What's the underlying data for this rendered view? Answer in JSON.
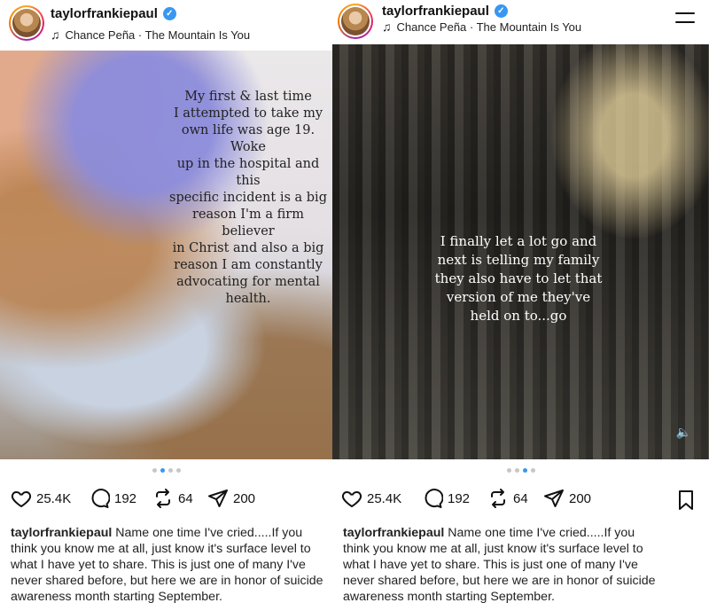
{
  "left_post": {
    "username": "taylorfrankiepaul",
    "music": "Chance Peña · The Mountain Is You",
    "overlay_lines": [
      "My first & last time",
      "I attempted to take my",
      "own life was age 19. Woke",
      "up in the hospital and this",
      "specific incident is a big",
      "reason I'm a firm believer",
      "in Christ and also a big",
      "reason I am constantly",
      "advocating for mental",
      "health."
    ],
    "carousel_dots": 4,
    "active_dot": 2,
    "likes": "25.4K",
    "comments": "192",
    "reposts": "64",
    "shares": "200",
    "caption_username": "taylorfrankiepaul",
    "caption_lines": [
      "Name one time I've cried.....If you",
      "think you know me at all, just know it's surface level to",
      "what I have yet to share. This is just one of many I've",
      "never shared before, but here we are in honor of suicide",
      "awareness month starting September."
    ]
  },
  "right_post": {
    "username": "taylorfrankiepaul",
    "music": "Chance Peña · The Mountain Is You",
    "overlay_lines": [
      "I finally let a lot go and",
      "next is telling my family",
      "they also have to let that",
      "version of me they've",
      "held on to...go"
    ],
    "carousel_dots": 4,
    "active_dot": 3,
    "likes": "25.4K",
    "comments": "192",
    "reposts": "64",
    "shares": "200",
    "caption_username": "taylorfrankiepaul",
    "caption_lines": [
      "Name one time I've cried.....If you",
      "think you know me at all, just know it's surface level to",
      "what I have yet to share. This is just one of many I've",
      "never shared before, but here we are in honor of suicide",
      "awareness month starting September."
    ]
  },
  "icons": {
    "verified": "verified-badge-icon",
    "music": "music-note-icon",
    "like": "heart-icon",
    "comment": "comment-icon",
    "repost": "repost-icon",
    "share": "send-icon",
    "save": "bookmark-icon",
    "menu": "menu-icon",
    "sound": "sound-icon"
  },
  "colors": {
    "verified": "#3897f0",
    "active_dot": "#3897f0",
    "inactive_dot": "#c7c7c7"
  }
}
